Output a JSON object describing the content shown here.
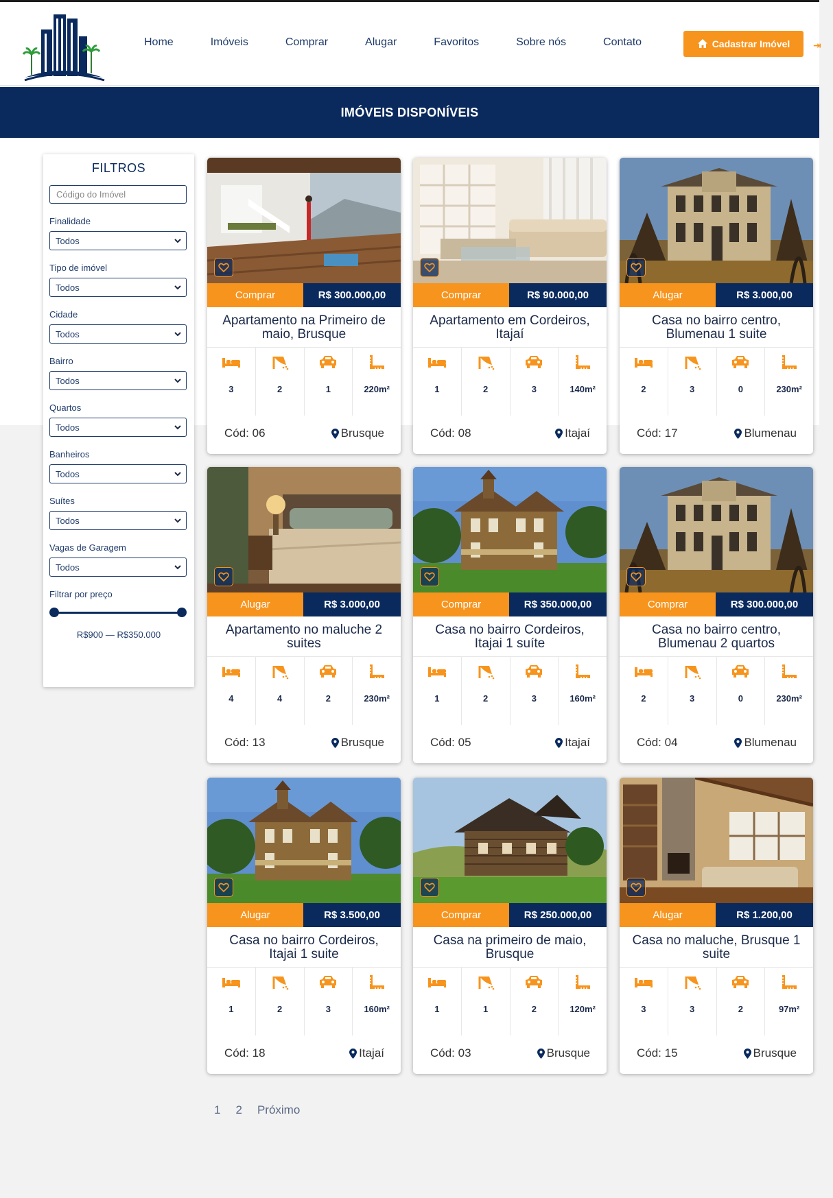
{
  "nav": {
    "items": [
      "Home",
      "Imóveis",
      "Comprar",
      "Alugar",
      "Favoritos",
      "Sobre nós",
      "Contato"
    ],
    "cta_label": "Cadastrar Imóvel",
    "cta_icon": "home-icon"
  },
  "banner": {
    "title": "IMÓVEIS DISPONÍVEIS"
  },
  "filters": {
    "title": "FILTROS",
    "code_placeholder": "Código do Imóvel",
    "fields": [
      {
        "label": "Finalidade",
        "value": "Todos"
      },
      {
        "label": "Tipo de imóvel",
        "value": "Todos"
      },
      {
        "label": "Cidade",
        "value": "Todos"
      },
      {
        "label": "Bairro",
        "value": "Todos"
      },
      {
        "label": "Quartos",
        "value": "Todos"
      },
      {
        "label": "Banheiros",
        "value": "Todos"
      },
      {
        "label": "Suítes",
        "value": "Todos"
      },
      {
        "label": "Vagas de Garagem",
        "value": "Todos"
      }
    ],
    "price_label": "Filtrar por preço",
    "price_min": "R$900",
    "price_max": "R$350.000"
  },
  "colors": {
    "navy": "#0a2a5e",
    "orange": "#f7941d"
  },
  "listings": [
    {
      "purpose": "Comprar",
      "price": "R$ 300.000,00",
      "title": "Apartamento na Primeiro de maio, Brusque",
      "beds": "3",
      "baths": "2",
      "cars": "1",
      "area": "220m²",
      "code": "Cód: 06",
      "city": "Brusque",
      "photo": "modern-interior"
    },
    {
      "purpose": "Comprar",
      "price": "R$ 90.000,00",
      "title": "Apartamento em Cordeiros, Itajaí",
      "beds": "1",
      "baths": "2",
      "cars": "3",
      "area": "140m²",
      "code": "Cód: 08",
      "city": "Itajaí",
      "photo": "living-room"
    },
    {
      "purpose": "Alugar",
      "price": "R$ 3.000,00",
      "title": "Casa no bairro centro, Blumenau 1 suite",
      "beds": "2",
      "baths": "3",
      "cars": "0",
      "area": "230m²",
      "code": "Cód: 17",
      "city": "Blumenau",
      "photo": "old-mansion"
    },
    {
      "purpose": "Alugar",
      "price": "R$ 3.000,00",
      "title": "Apartamento no maluche 2 suites",
      "beds": "4",
      "baths": "4",
      "cars": "2",
      "area": "230m²",
      "code": "Cód: 13",
      "city": "Brusque",
      "photo": "bedroom"
    },
    {
      "purpose": "Comprar",
      "price": "R$ 350.000,00",
      "title": "Casa no bairro Cordeiros, Itajai 1 suíte",
      "beds": "1",
      "baths": "2",
      "cars": "3",
      "area": "160m²",
      "code": "Cód: 05",
      "city": "Itajaí",
      "photo": "victorian-house"
    },
    {
      "purpose": "Comprar",
      "price": "R$ 300.000,00",
      "title": "Casa no bairro centro, Blumenau 2 quartos",
      "beds": "2",
      "baths": "3",
      "cars": "0",
      "area": "230m²",
      "code": "Cód: 04",
      "city": "Blumenau",
      "photo": "old-mansion"
    },
    {
      "purpose": "Alugar",
      "price": "R$ 3.500,00",
      "title": "Casa no bairro Cordeiros, Itajai 1 suite",
      "beds": "1",
      "baths": "2",
      "cars": "3",
      "area": "160m²",
      "code": "Cód: 18",
      "city": "Itajaí",
      "photo": "victorian-house"
    },
    {
      "purpose": "Comprar",
      "price": "R$ 250.000,00",
      "title": "Casa na primeiro de maio, Brusque",
      "beds": "1",
      "baths": "1",
      "cars": "2",
      "area": "120m²",
      "code": "Cód: 03",
      "city": "Brusque",
      "photo": "wooden-house"
    },
    {
      "purpose": "Alugar",
      "price": "R$ 1.200,00",
      "title": "Casa no maluche, Brusque 1 suite",
      "beds": "3",
      "baths": "3",
      "cars": "2",
      "area": "97m²",
      "code": "Cód: 15",
      "city": "Brusque",
      "photo": "cabin-interior"
    }
  ],
  "pagination": {
    "pages": [
      "1",
      "2"
    ],
    "next_label": "Próximo"
  }
}
